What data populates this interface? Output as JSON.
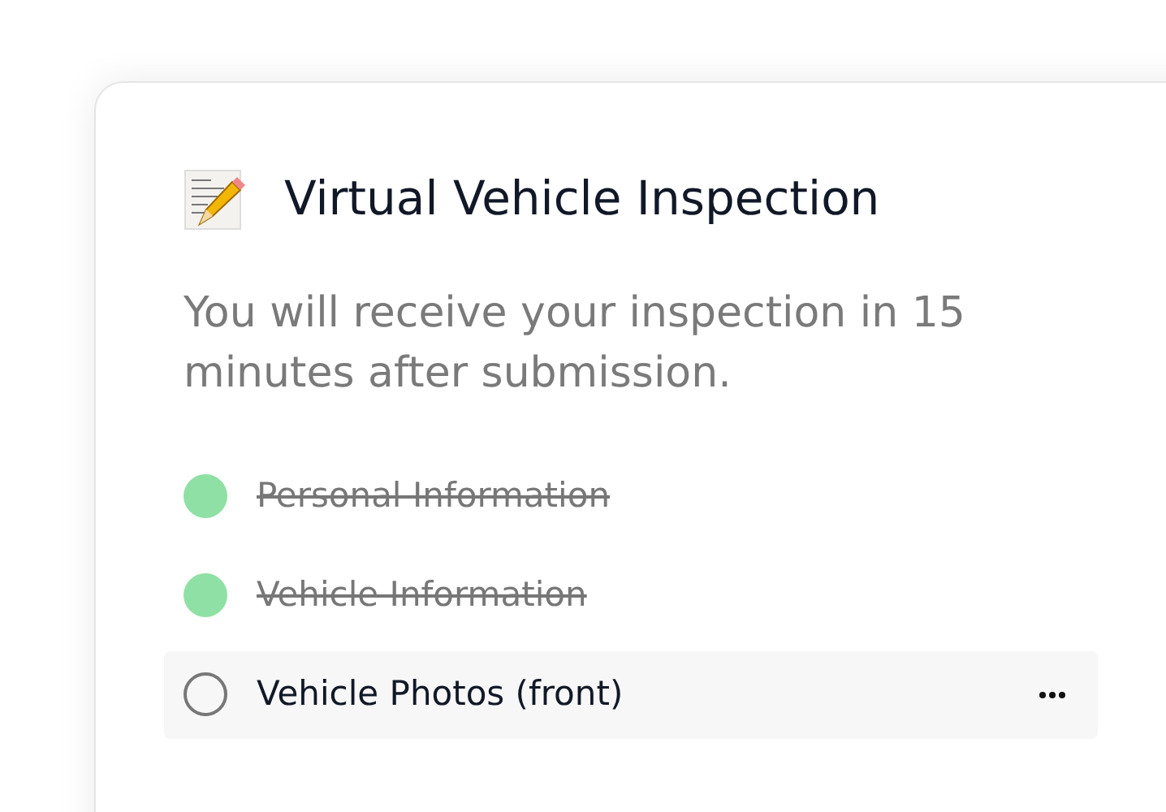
{
  "card": {
    "title": "Virtual Vehicle Inspection",
    "subtitle": "You will receive your inspection in 15 minutes after submission.",
    "steps": [
      {
        "label": "Personal Information",
        "done": true,
        "selected": false
      },
      {
        "label": "Vehicle Information",
        "done": true,
        "selected": false
      },
      {
        "label": "Vehicle Photos (front)",
        "done": false,
        "selected": true
      }
    ]
  }
}
